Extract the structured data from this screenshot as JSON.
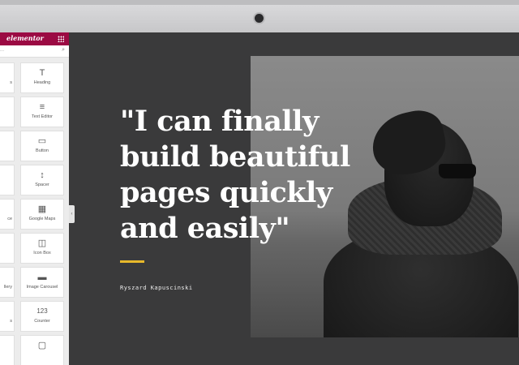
{
  "sidebar": {
    "logo": "elementor",
    "search_placeholder": "...",
    "widgets_right": [
      {
        "label": "Heading",
        "icon": "T"
      },
      {
        "label": "Text Editor",
        "icon": "≡"
      },
      {
        "label": "Button",
        "icon": "▭"
      },
      {
        "label": "Spacer",
        "icon": "↕"
      },
      {
        "label": "Google Maps",
        "icon": "▦"
      },
      {
        "label": "Icon Box",
        "icon": "◫"
      },
      {
        "label": "Image Carousel",
        "icon": "▬"
      },
      {
        "label": "Counter",
        "icon": "123"
      },
      {
        "label": "",
        "icon": "▢"
      }
    ],
    "widgets_left": [
      "s",
      "",
      "",
      "",
      "ce",
      "",
      "llery",
      "s",
      ""
    ],
    "collapse_icon": "‹"
  },
  "hero": {
    "quote": "\"I can finally build beautiful pages quickly and easily\"",
    "author": "Ryszard Kapuscinski",
    "accent_color": "#e8b92b"
  }
}
